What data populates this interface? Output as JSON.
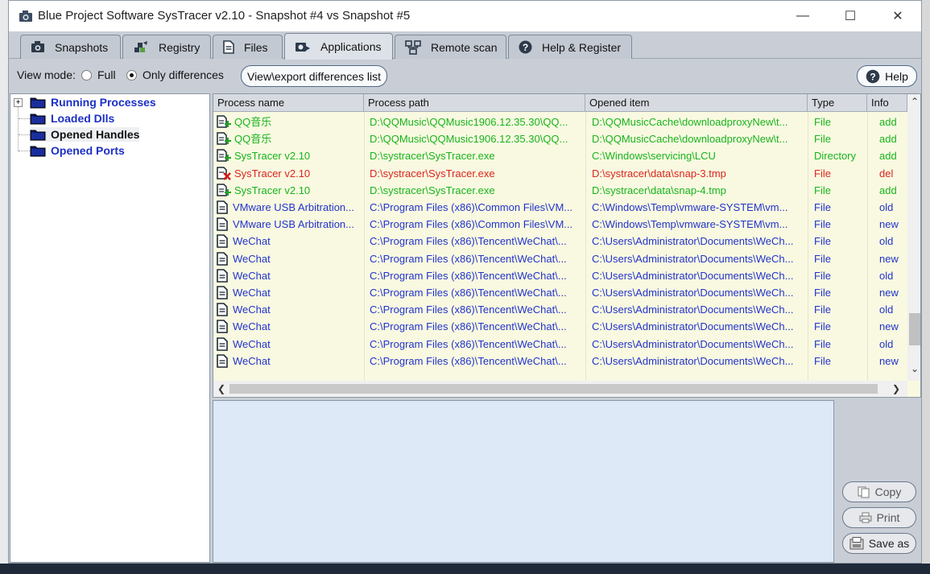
{
  "window": {
    "title": "Blue Project Software SysTracer v2.10 - Snapshot #4 vs Snapshot #5",
    "minimize": "—",
    "maximize": "☐",
    "close": "✕"
  },
  "tabs": [
    {
      "label": "Snapshots",
      "icon": "camera-icon"
    },
    {
      "label": "Registry",
      "icon": "registry-icon"
    },
    {
      "label": "Files",
      "icon": "file-icon"
    },
    {
      "label": "Applications",
      "icon": "applications-icon",
      "active": true
    },
    {
      "label": "Remote scan",
      "icon": "network-icon"
    },
    {
      "label": "Help & Register",
      "icon": "help-icon"
    }
  ],
  "toolbar": {
    "view_mode_label": "View mode:",
    "full_label": "Full",
    "only_diff_label": "Only differences",
    "selected_mode": "Only differences",
    "export_label": "View\\export differences list",
    "help_label": "Help"
  },
  "tree": {
    "expander": "+",
    "items": [
      {
        "label": "Running Processes",
        "color": "#1c2fc4"
      },
      {
        "label": "Loaded Dlls",
        "color": "#1c2fc4"
      },
      {
        "label": "Opened Handles",
        "color": "#111111"
      },
      {
        "label": "Opened Ports",
        "color": "#1c2fc4"
      }
    ]
  },
  "grid": {
    "columns": [
      "Process name",
      "Process path",
      "Opened item",
      "Type",
      "Info"
    ],
    "rows": [
      {
        "name": "QQ音乐",
        "path": "D:\\QQMusic\\QQMusic1906.12.35.30\\QQ...",
        "item": "D:\\QQMusicCache\\downloadproxyNew\\t...",
        "type": "File",
        "info": "add",
        "status": "add"
      },
      {
        "name": "QQ音乐",
        "path": "D:\\QQMusic\\QQMusic1906.12.35.30\\QQ...",
        "item": "D:\\QQMusicCache\\downloadproxyNew\\t...",
        "type": "File",
        "info": "add",
        "status": "add"
      },
      {
        "name": "SysTracer v2.10",
        "path": "D:\\systracer\\SysTracer.exe",
        "item": "C:\\Windows\\servicing\\LCU",
        "type": "Directory",
        "info": "add",
        "status": "add"
      },
      {
        "name": "SysTracer v2.10",
        "path": "D:\\systracer\\SysTracer.exe",
        "item": "D:\\systracer\\data\\snap-3.tmp",
        "type": "File",
        "info": "del",
        "status": "del"
      },
      {
        "name": "SysTracer v2.10",
        "path": "D:\\systracer\\SysTracer.exe",
        "item": "D:\\systracer\\data\\snap-4.tmp",
        "type": "File",
        "info": "add",
        "status": "add"
      },
      {
        "name": "VMware USB Arbitration...",
        "path": "C:\\Program Files (x86)\\Common Files\\VM...",
        "item": "C:\\Windows\\Temp\\vmware-SYSTEM\\vm...",
        "type": "File",
        "info": "old",
        "status": "old"
      },
      {
        "name": "VMware USB Arbitration...",
        "path": "C:\\Program Files (x86)\\Common Files\\VM...",
        "item": "C:\\Windows\\Temp\\vmware-SYSTEM\\vm...",
        "type": "File",
        "info": "new",
        "status": "new"
      },
      {
        "name": "WeChat",
        "path": "C:\\Program Files (x86)\\Tencent\\WeChat\\...",
        "item": "C:\\Users\\Administrator\\Documents\\WeCh...",
        "type": "File",
        "info": "old",
        "status": "old"
      },
      {
        "name": "WeChat",
        "path": "C:\\Program Files (x86)\\Tencent\\WeChat\\...",
        "item": "C:\\Users\\Administrator\\Documents\\WeCh...",
        "type": "File",
        "info": "new",
        "status": "new"
      },
      {
        "name": "WeChat",
        "path": "C:\\Program Files (x86)\\Tencent\\WeChat\\...",
        "item": "C:\\Users\\Administrator\\Documents\\WeCh...",
        "type": "File",
        "info": "old",
        "status": "old"
      },
      {
        "name": "WeChat",
        "path": "C:\\Program Files (x86)\\Tencent\\WeChat\\...",
        "item": "C:\\Users\\Administrator\\Documents\\WeCh...",
        "type": "File",
        "info": "new",
        "status": "new"
      },
      {
        "name": "WeChat",
        "path": "C:\\Program Files (x86)\\Tencent\\WeChat\\...",
        "item": "C:\\Users\\Administrator\\Documents\\WeCh...",
        "type": "File",
        "info": "old",
        "status": "old"
      },
      {
        "name": "WeChat",
        "path": "C:\\Program Files (x86)\\Tencent\\WeChat\\...",
        "item": "C:\\Users\\Administrator\\Documents\\WeCh...",
        "type": "File",
        "info": "new",
        "status": "new"
      },
      {
        "name": "WeChat",
        "path": "C:\\Program Files (x86)\\Tencent\\WeChat\\...",
        "item": "C:\\Users\\Administrator\\Documents\\WeCh...",
        "type": "File",
        "info": "old",
        "status": "old"
      },
      {
        "name": "WeChat",
        "path": "C:\\Program Files (x86)\\Tencent\\WeChat\\...",
        "item": "C:\\Users\\Administrator\\Documents\\WeCh...",
        "type": "File",
        "info": "new",
        "status": "new"
      }
    ],
    "status_colors": {
      "add": "#19b41c",
      "del": "#d9261c",
      "old": "#2233cc",
      "new": "#2233cc"
    },
    "scroll_up": "⌃",
    "scroll_down": "⌄",
    "scroll_left": "❮",
    "scroll_right": "❯"
  },
  "side_buttons": {
    "copy": "Copy",
    "print": "Print",
    "save_as": "Save as"
  },
  "colors": {
    "window_bg": "#c9ced6",
    "grid_bg": "#f9f9e1",
    "details_bg": "#dde9f6"
  }
}
